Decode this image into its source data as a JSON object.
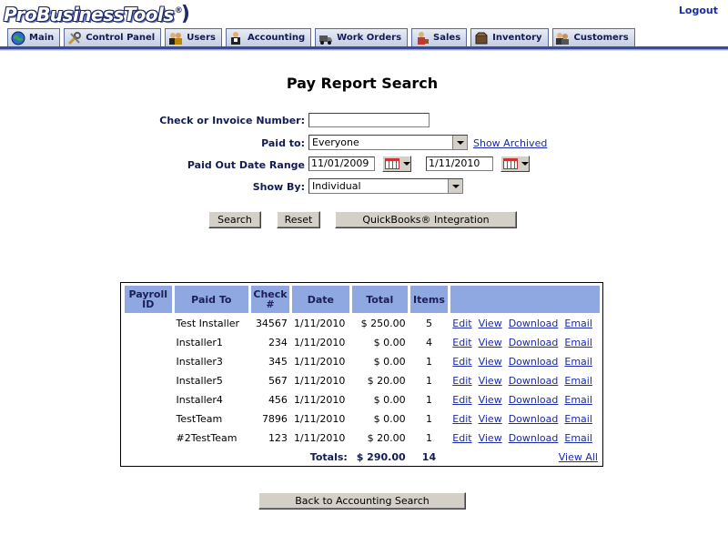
{
  "header": {
    "logo_main": "ProBusinessTools",
    "logo_tm": "®",
    "logout": "Logout"
  },
  "tabs": [
    {
      "label": "Main",
      "icon": "globe-icon"
    },
    {
      "label": "Control Panel",
      "icon": "tools-icon"
    },
    {
      "label": "Users",
      "icon": "users-icon"
    },
    {
      "label": "Accounting",
      "icon": "accountant-icon"
    },
    {
      "label": "Work Orders",
      "icon": "truck-icon"
    },
    {
      "label": "Sales",
      "icon": "salesperson-icon"
    },
    {
      "label": "Inventory",
      "icon": "box-icon"
    },
    {
      "label": "Customers",
      "icon": "customers-icon"
    }
  ],
  "form": {
    "title": "Pay Report Search",
    "check_label": "Check or Invoice Number:",
    "check_value": "",
    "paid_to_label": "Paid to:",
    "paid_to_value": "Everyone",
    "show_archived": "Show Archived",
    "date_range_label": "Paid Out Date Range",
    "date_from": "11/01/2009",
    "date_to": "1/11/2010",
    "show_by_label": "Show By:",
    "show_by_value": "Individual",
    "search_button": "Search",
    "reset_button": "Reset",
    "quickbooks_button": "QuickBooks® Integration"
  },
  "table": {
    "headers": {
      "payroll_id_1": "Payroll",
      "payroll_id_2": "ID",
      "paid_to": "Paid To",
      "check_1": "Check",
      "check_2": "#",
      "date": "Date",
      "total": "Total",
      "items": "Items"
    },
    "rows": [
      {
        "payroll_id": "",
        "paid_to": "Test Installer",
        "check": "34567",
        "date": "1/11/2010",
        "total": "$ 250.00",
        "items": "5"
      },
      {
        "payroll_id": "",
        "paid_to": "Installer1",
        "check": "234",
        "date": "1/11/2010",
        "total": "$ 0.00",
        "items": "4"
      },
      {
        "payroll_id": "",
        "paid_to": "Installer3",
        "check": "345",
        "date": "1/11/2010",
        "total": "$ 0.00",
        "items": "1"
      },
      {
        "payroll_id": "",
        "paid_to": "Installer5",
        "check": "567",
        "date": "1/11/2010",
        "total": "$ 20.00",
        "items": "1"
      },
      {
        "payroll_id": "",
        "paid_to": "Installer4",
        "check": "456",
        "date": "1/11/2010",
        "total": "$ 0.00",
        "items": "1"
      },
      {
        "payroll_id": "",
        "paid_to": "TestTeam",
        "check": "7896",
        "date": "1/11/2010",
        "total": "$ 0.00",
        "items": "1"
      },
      {
        "payroll_id": "",
        "paid_to": "#2TestTeam",
        "check": "123",
        "date": "1/11/2010",
        "total": "$ 20.00",
        "items": "1"
      }
    ],
    "actions": {
      "edit": "Edit",
      "view": "View",
      "download": "Download",
      "email": "Email"
    },
    "totals_label": "Totals:",
    "totals_amount": "$ 290.00",
    "totals_items": "14",
    "view_all": "View All"
  },
  "footer": {
    "back_button": "Back to Accounting Search"
  },
  "colors": {
    "header_blue": "#8fa8e2",
    "label_navy": "#121b55",
    "link_blue": "#1a2aa8",
    "tab_line": "#3a4aa0"
  }
}
